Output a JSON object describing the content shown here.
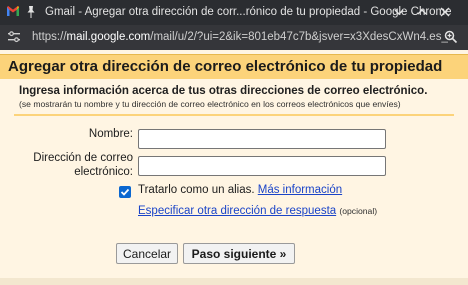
{
  "window": {
    "title": "Gmail - Agregar otra dirección de corr...rónico de tu propiedad - Google Chrome",
    "url_prefix": "https://",
    "url_host": "mail.google.com",
    "url_rest": "/mail/u/2/?ui=2&ik=801eb47c7b&jsver=x3XdesCxWn4.es_"
  },
  "dialog": {
    "title": "Agregar otra dirección de correo electrónico de tu propiedad",
    "subtitle": "Ingresa información acerca de tus otras direcciones de correo electrónico.",
    "note": "(se mostrarán tu nombre y tu dirección de correo electrónico en los correos electrónicos que envíes)",
    "form": {
      "name_label": "Nombre:",
      "name_value": "",
      "email_label_line1": "Dirección de correo",
      "email_label_line2": "electrónico:",
      "email_value": "",
      "alias_checked": true,
      "alias_label": "Tratarlo como un alias.",
      "more_info_link": "Más información",
      "reply_link": "Especificar otra dirección de respuesta",
      "reply_optional": "(opcional)"
    },
    "buttons": {
      "cancel": "Cancelar",
      "next": "Paso siguiente »"
    }
  },
  "colors": {
    "accent_band": "#fcd37a",
    "background": "#fff5e3",
    "link": "#1a44c8",
    "checkbox": "#0b67d0"
  }
}
